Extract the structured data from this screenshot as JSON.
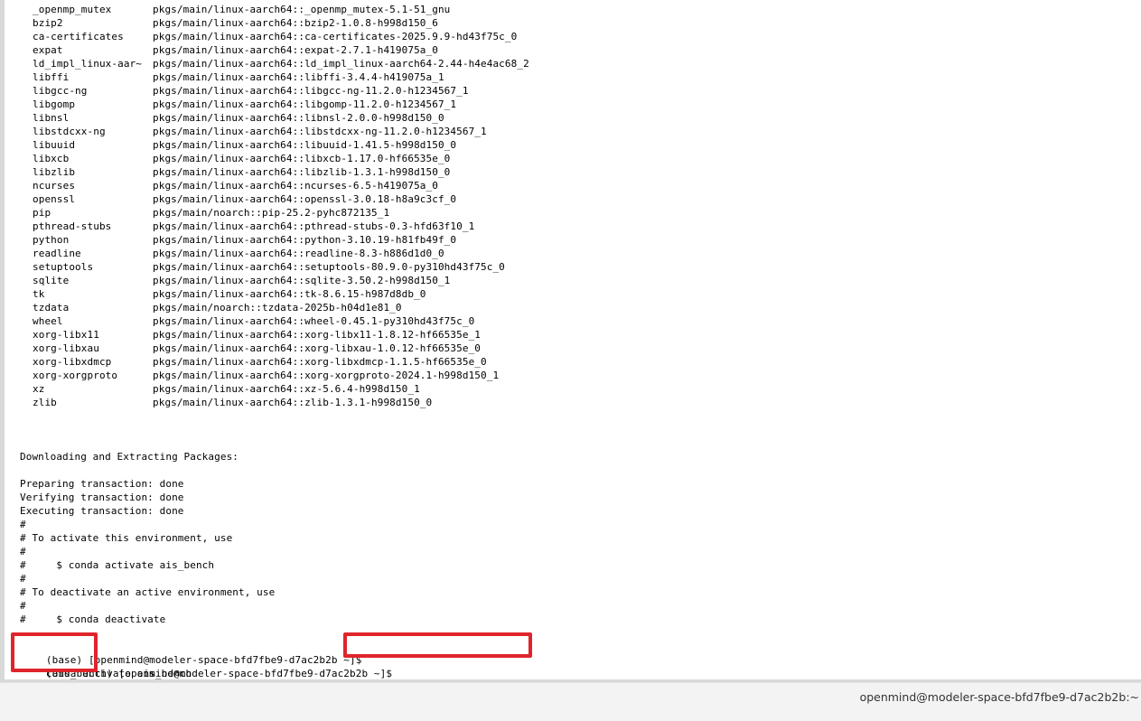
{
  "terminal": {
    "packages": [
      {
        "name": "_openmp_mutex",
        "src": "pkgs/main/linux-aarch64::_openmp_mutex-5.1-51_gnu"
      },
      {
        "name": "bzip2",
        "src": "pkgs/main/linux-aarch64::bzip2-1.0.8-h998d150_6"
      },
      {
        "name": "ca-certificates",
        "src": "pkgs/main/linux-aarch64::ca-certificates-2025.9.9-hd43f75c_0"
      },
      {
        "name": "expat",
        "src": "pkgs/main/linux-aarch64::expat-2.7.1-h419075a_0"
      },
      {
        "name": "ld_impl_linux-aar~",
        "src": "pkgs/main/linux-aarch64::ld_impl_linux-aarch64-2.44-h4e4ac68_2"
      },
      {
        "name": "libffi",
        "src": "pkgs/main/linux-aarch64::libffi-3.4.4-h419075a_1"
      },
      {
        "name": "libgcc-ng",
        "src": "pkgs/main/linux-aarch64::libgcc-ng-11.2.0-h1234567_1"
      },
      {
        "name": "libgomp",
        "src": "pkgs/main/linux-aarch64::libgomp-11.2.0-h1234567_1"
      },
      {
        "name": "libnsl",
        "src": "pkgs/main/linux-aarch64::libnsl-2.0.0-h998d150_0"
      },
      {
        "name": "libstdcxx-ng",
        "src": "pkgs/main/linux-aarch64::libstdcxx-ng-11.2.0-h1234567_1"
      },
      {
        "name": "libuuid",
        "src": "pkgs/main/linux-aarch64::libuuid-1.41.5-h998d150_0"
      },
      {
        "name": "libxcb",
        "src": "pkgs/main/linux-aarch64::libxcb-1.17.0-hf66535e_0"
      },
      {
        "name": "libzlib",
        "src": "pkgs/main/linux-aarch64::libzlib-1.3.1-h998d150_0"
      },
      {
        "name": "ncurses",
        "src": "pkgs/main/linux-aarch64::ncurses-6.5-h419075a_0"
      },
      {
        "name": "openssl",
        "src": "pkgs/main/linux-aarch64::openssl-3.0.18-h8a9c3cf_0"
      },
      {
        "name": "pip",
        "src": "pkgs/main/noarch::pip-25.2-pyhc872135_1"
      },
      {
        "name": "pthread-stubs",
        "src": "pkgs/main/linux-aarch64::pthread-stubs-0.3-hfd63f10_1"
      },
      {
        "name": "python",
        "src": "pkgs/main/linux-aarch64::python-3.10.19-h81fb49f_0"
      },
      {
        "name": "readline",
        "src": "pkgs/main/linux-aarch64::readline-8.3-h886d1d0_0"
      },
      {
        "name": "setuptools",
        "src": "pkgs/main/linux-aarch64::setuptools-80.9.0-py310hd43f75c_0"
      },
      {
        "name": "sqlite",
        "src": "pkgs/main/linux-aarch64::sqlite-3.50.2-h998d150_1"
      },
      {
        "name": "tk",
        "src": "pkgs/main/linux-aarch64::tk-8.6.15-h987d8db_0"
      },
      {
        "name": "tzdata",
        "src": "pkgs/main/noarch::tzdata-2025b-h04d1e81_0"
      },
      {
        "name": "wheel",
        "src": "pkgs/main/linux-aarch64::wheel-0.45.1-py310hd43f75c_0"
      },
      {
        "name": "xorg-libx11",
        "src": "pkgs/main/linux-aarch64::xorg-libx11-1.8.12-hf66535e_1"
      },
      {
        "name": "xorg-libxau",
        "src": "pkgs/main/linux-aarch64::xorg-libxau-1.0.12-hf66535e_0"
      },
      {
        "name": "xorg-libxdmcp",
        "src": "pkgs/main/linux-aarch64::xorg-libxdmcp-1.1.5-hf66535e_0"
      },
      {
        "name": "xorg-xorgproto",
        "src": "pkgs/main/linux-aarch64::xorg-xorgproto-2024.1-h998d150_1"
      },
      {
        "name": "xz",
        "src": "pkgs/main/linux-aarch64::xz-5.6.4-h998d150_1"
      },
      {
        "name": "zlib",
        "src": "pkgs/main/linux-aarch64::zlib-1.3.1-h998d150_0"
      }
    ],
    "downloading": "Downloading and Extracting Packages:",
    "preparing": "Preparing transaction: done",
    "verifying": "Verifying transaction: done",
    "executing": "Executing transaction: done",
    "hash1": "#",
    "activate_note": "# To activate this environment, use",
    "hash2": "#",
    "activate_cmd": "#     $ conda activate ais_bench",
    "hash3": "#",
    "deactivate_note": "# To deactivate an active environment, use",
    "hash4": "#",
    "deactivate_cmd": "#     $ conda deactivate",
    "prompt1": "(base) [openmind@modeler-space-bfd7fbe9-d7ac2b2b ~]$",
    "command1": "conda activate ais_bench",
    "prompt2": "(ais_bench) [openmind@modeler-space-bfd7fbe9-d7ac2b2b ~]$"
  },
  "highlight_color": "#e0242b",
  "statusbar": {
    "text": "openmind@modeler-space-bfd7fbe9-d7ac2b2b:~"
  }
}
